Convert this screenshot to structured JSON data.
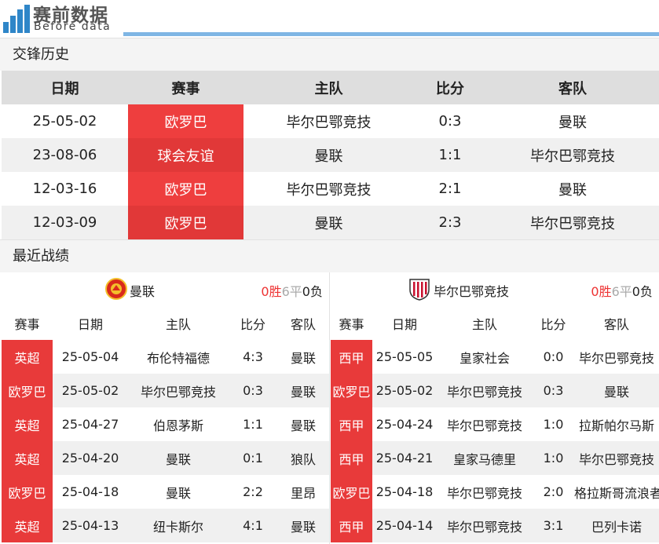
{
  "brand": {
    "title": "赛前数据",
    "subtitle": "Before data"
  },
  "h2h": {
    "title": "交锋历史",
    "headers": [
      "日期",
      "赛事",
      "主队",
      "比分",
      "客队"
    ],
    "rows": [
      [
        "25-05-02",
        "欧罗巴",
        "毕尔巴鄂竞技",
        "0:3",
        "曼联"
      ],
      [
        "23-08-06",
        "球会友谊",
        "曼联",
        "1:1",
        "毕尔巴鄂竞技"
      ],
      [
        "12-03-16",
        "欧罗巴",
        "毕尔巴鄂竞技",
        "2:1",
        "曼联"
      ],
      [
        "12-03-09",
        "欧罗巴",
        "曼联",
        "2:3",
        "毕尔巴鄂竞技"
      ]
    ]
  },
  "recent": {
    "title": "最近战绩",
    "headers": [
      "赛事",
      "日期",
      "主队",
      "比分",
      "客队"
    ],
    "left": {
      "team": "曼联",
      "record": {
        "w": "0",
        "w_label": "胜",
        "d": "6",
        "d_label": "平",
        "l": "0",
        "l_label": "负"
      },
      "rows": [
        [
          "英超",
          "25-05-04",
          "布伦特福德",
          "4:3",
          "曼联"
        ],
        [
          "欧罗巴",
          "25-05-02",
          "毕尔巴鄂竞技",
          "0:3",
          "曼联"
        ],
        [
          "英超",
          "25-04-27",
          "伯恩茅斯",
          "1:1",
          "曼联"
        ],
        [
          "英超",
          "25-04-20",
          "曼联",
          "0:1",
          "狼队"
        ],
        [
          "欧罗巴",
          "25-04-18",
          "曼联",
          "2:2",
          "里昂"
        ],
        [
          "英超",
          "25-04-13",
          "纽卡斯尔",
          "4:1",
          "曼联"
        ]
      ]
    },
    "right": {
      "team": "毕尔巴鄂竞技",
      "record": {
        "w": "0",
        "w_label": "胜",
        "d": "6",
        "d_label": "平",
        "l": "0",
        "l_label": "负"
      },
      "rows": [
        [
          "西甲",
          "25-05-05",
          "皇家社会",
          "0:0",
          "毕尔巴鄂竞技"
        ],
        [
          "欧罗巴",
          "25-05-02",
          "毕尔巴鄂竞技",
          "0:3",
          "曼联"
        ],
        [
          "西甲",
          "25-04-24",
          "毕尔巴鄂竞技",
          "1:0",
          "拉斯帕尔马斯"
        ],
        [
          "西甲",
          "25-04-21",
          "皇家马德里",
          "1:0",
          "毕尔巴鄂竞技"
        ],
        [
          "欧罗巴",
          "25-04-18",
          "毕尔巴鄂竞技",
          "2:0",
          "格拉斯哥流浪者"
        ],
        [
          "西甲",
          "25-04-14",
          "毕尔巴鄂竞技",
          "3:1",
          "巴列卡诺"
        ]
      ]
    }
  },
  "colors": {
    "accent": "#7fb6e4",
    "comp_red": "#e83a3a"
  }
}
